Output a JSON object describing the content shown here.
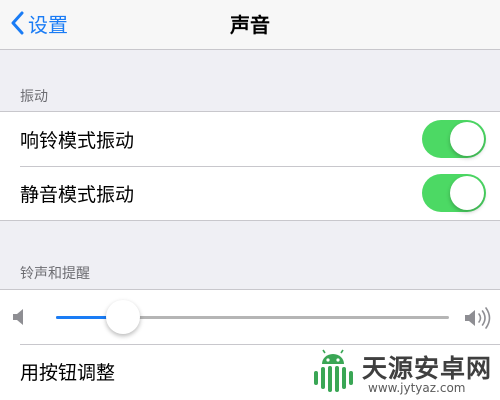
{
  "navbar": {
    "back_label": "设置",
    "title": "声音"
  },
  "vibration": {
    "header": "振动",
    "rows": [
      {
        "label": "响铃模式振动",
        "on": true
      },
      {
        "label": "静音模式振动",
        "on": true
      }
    ]
  },
  "ringtone": {
    "header": "铃声和提醒",
    "volume_level": 0.17,
    "button_row_label": "用按钮调整"
  },
  "watermark": {
    "title": "天源安卓网",
    "url": "www.jytyaz.com"
  },
  "colors": {
    "accent": "#1a7cf5",
    "switch_on": "#4cd964",
    "background": "#efeff4"
  },
  "icons": {
    "back": "chevron-left-icon",
    "volume_low": "speaker-low-icon",
    "volume_high": "speaker-high-icon",
    "watermark": "android-logo-icon"
  }
}
